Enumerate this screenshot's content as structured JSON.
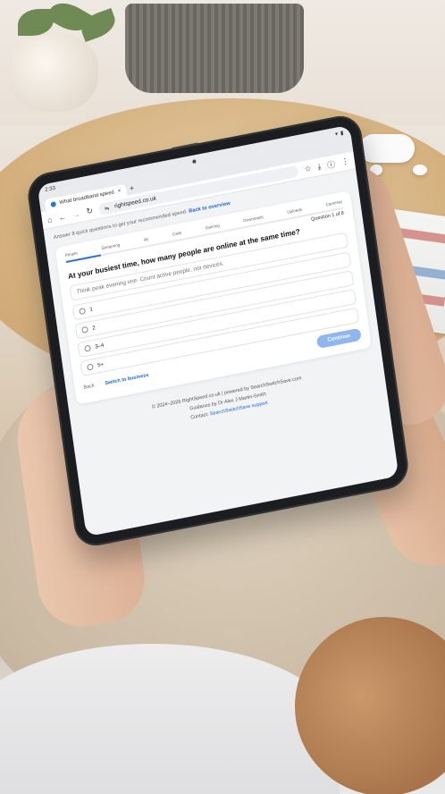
{
  "browser": {
    "status_time": "2:33",
    "tab_title": "What broadband speed do y",
    "tab_close": "×",
    "new_tab": "+",
    "url": "rightspeed.co.uk"
  },
  "page": {
    "intro_text": "Answer 8 quick questions to get your recommended speed.",
    "intro_link": "Back to overview",
    "categories": [
      "People",
      "Streaming",
      "4K",
      "Calls",
      "Gaming",
      "Downloads",
      "Uploads",
      "Cameras"
    ],
    "progress_fraction": 0.125,
    "question_counter": "Question 1 of 8",
    "question": "At your busiest time, how many people are online at the same time?",
    "hint": "Think peak evening use. Count active people, not devices.",
    "options": [
      "1",
      "2",
      "3–4",
      "5+"
    ],
    "back_label": "Back",
    "switch_label": "Switch to business",
    "continue_label": "Continue"
  },
  "footer": {
    "line1": "© 2024–2026 RightSpeed.co.uk | powered by SearchSwitchSave.com",
    "line2": "Guidance by Dr Alex J Martin-Smith",
    "line3_prefix": "Contact:",
    "line3_link": "SearchSwitchSave support"
  }
}
